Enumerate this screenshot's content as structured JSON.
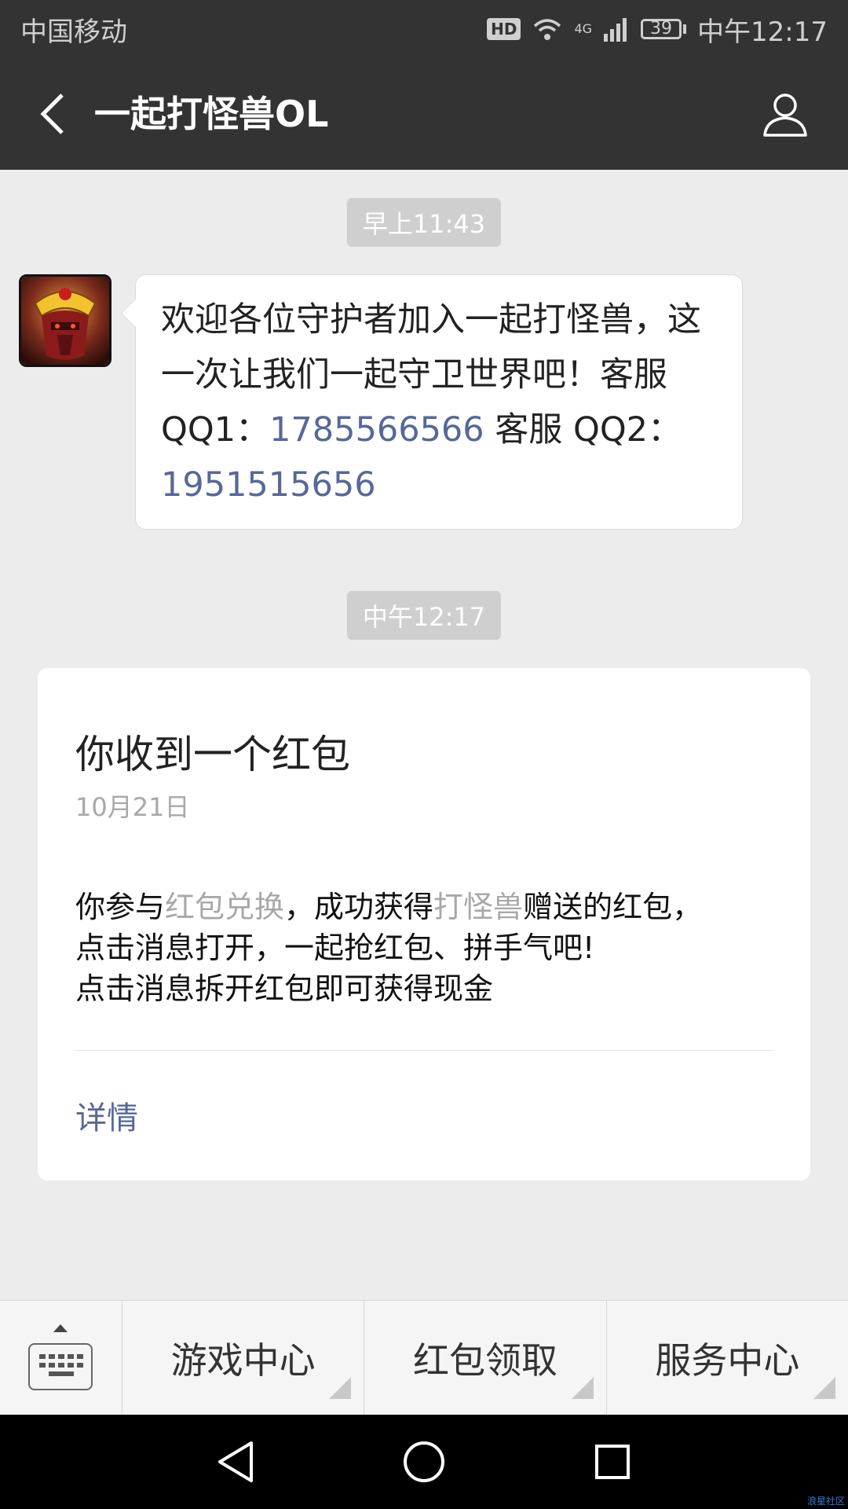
{
  "status_bar": {
    "carrier": "中国移动",
    "network": "4G",
    "hd": "HD",
    "battery": "39",
    "time": "中午12:17"
  },
  "header": {
    "title": "一起打怪兽OL"
  },
  "chat": {
    "messages": [
      {
        "timestamp": "早上11:43",
        "text_part1": "欢迎各位守护者加入一起打怪兽，这一次让我们一起守卫世界吧！客服 QQ1：",
        "qq1": "1785566566",
        "text_part2": "  客服 QQ2：",
        "qq2": "1951515656"
      },
      {
        "timestamp": "中午12:17",
        "card": {
          "title": "你收到一个红包",
          "date": "10月21日",
          "body_1": "你参与",
          "body_highlight_1": "红包兑换",
          "body_2": "，成功获得",
          "body_highlight_2": "打怪兽",
          "body_3": "赠送的红包，",
          "body_line2": "点击消息打开，一起抢红包、拼手气吧!",
          "body_line3": "点击消息拆开红包即可获得现金",
          "link": "详情"
        }
      }
    ]
  },
  "bottom_menu": {
    "items": [
      {
        "label": "游戏中心"
      },
      {
        "label": "红包领取"
      },
      {
        "label": "服务中心"
      }
    ]
  },
  "watermark": "浪星社区",
  "colors": {
    "header_bg": "#333333",
    "chat_bg": "#ececec",
    "link": "#56689a",
    "highlight_gray": "#a8a8a8"
  }
}
